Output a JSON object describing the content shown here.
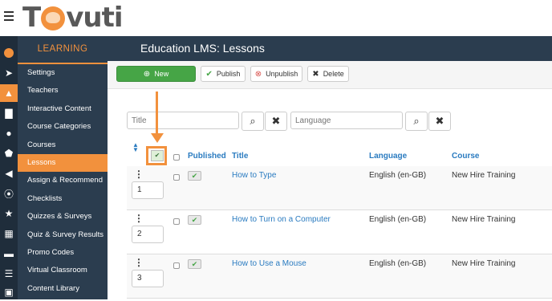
{
  "app": {
    "logo_text_left": "T",
    "logo_text_right": "vuti"
  },
  "iconbar": {
    "icons": [
      "avatar-icon",
      "rocket-icon",
      "graduation-cap-icon",
      "bar-chart-icon",
      "users-icon",
      "trophy-icon",
      "megaphone-icon",
      "feed-icon",
      "star-icon",
      "table-icon",
      "credit-card-icon",
      "sitemap-icon",
      "id-card-icon"
    ]
  },
  "sidebar": {
    "heading": "LEARNING",
    "items": [
      {
        "label": "Settings"
      },
      {
        "label": "Teachers"
      },
      {
        "label": "Interactive Content"
      },
      {
        "label": "Course Categories"
      },
      {
        "label": "Courses"
      },
      {
        "label": "Lessons"
      },
      {
        "label": "Assign & Recommend"
      },
      {
        "label": "Checklists"
      },
      {
        "label": "Quizzes & Surveys"
      },
      {
        "label": "Quiz & Survey Results"
      },
      {
        "label": "Promo Codes"
      },
      {
        "label": "Virtual Classroom"
      },
      {
        "label": "Content Library"
      }
    ],
    "active_index": 5
  },
  "header": {
    "title": "Education LMS: Lessons"
  },
  "toolbar": {
    "new_label": "New",
    "publish_label": "Publish",
    "unpublish_label": "Unpublish",
    "delete_label": "Delete"
  },
  "filters": {
    "title_placeholder": "Title",
    "language_placeholder": "Language"
  },
  "table": {
    "columns": {
      "published": "Published",
      "title": "Title",
      "language": "Language",
      "course": "Course"
    },
    "rows": [
      {
        "order": "1",
        "title": "How to Type",
        "language": "English (en-GB)",
        "course": "New Hire Training"
      },
      {
        "order": "2",
        "title": "How to Turn on a Computer",
        "language": "English (en-GB)",
        "course": "New Hire Training"
      },
      {
        "order": "3",
        "title": "How to Use a Mouse",
        "language": "English (en-GB)",
        "course": "New Hire Training"
      }
    ]
  },
  "colors": {
    "accent": "#f2913d",
    "sidebar": "#2b3d4f",
    "link": "#2a7bc0",
    "new_button": "#46a546"
  }
}
